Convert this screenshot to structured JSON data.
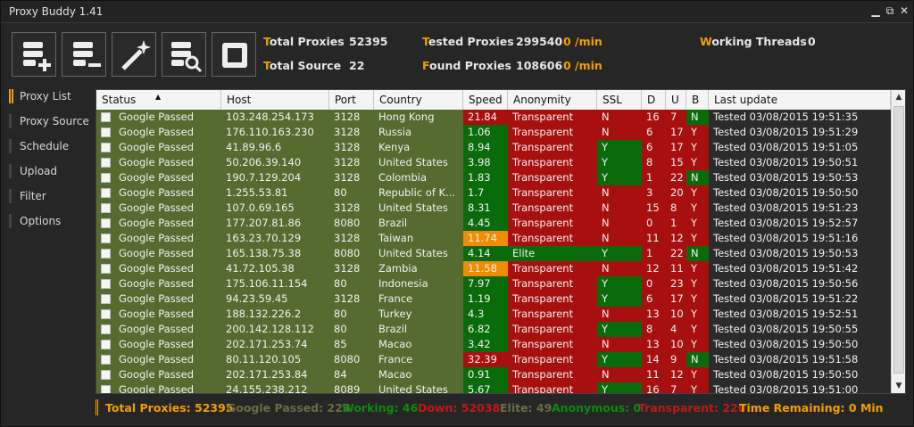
{
  "window": {
    "title": "Proxy Buddy 1.41",
    "min": "▁",
    "max": "⧉",
    "close": "✕"
  },
  "toolbar": {
    "buttons": [
      "add-list-icon",
      "remove-list-icon",
      "magic-wand-icon",
      "search-list-icon",
      "stop-icon"
    ]
  },
  "stats": {
    "total_proxies": {
      "first": "T",
      "rest": "otal Proxies",
      "value": "52395"
    },
    "total_source": {
      "first": "T",
      "rest": "otal Source",
      "value": "22"
    },
    "tested_proxies": {
      "first": "T",
      "rest": "ested Proxies",
      "value": "299540",
      "rate": "0 /min"
    },
    "found_proxies": {
      "first": "F",
      "rest": "ound Proxies",
      "value": "108606",
      "rate": "0 /min"
    },
    "working_threads": {
      "first": "W",
      "rest": "orking Threads",
      "value": "0"
    }
  },
  "sidebar": {
    "items": [
      {
        "label": "Proxy List"
      },
      {
        "label": "Proxy Source"
      },
      {
        "label": "Schedule"
      },
      {
        "label": "Upload"
      },
      {
        "label": "Filter"
      },
      {
        "label": "Options"
      }
    ]
  },
  "table": {
    "headers": [
      "Status",
      "Host",
      "Port",
      "Country",
      "Speed",
      "Anonymity",
      "SSL",
      "D",
      "U",
      "B",
      "Last update"
    ],
    "sort_indicator": "▲",
    "rows": [
      [
        "Google Passed",
        "103.248.254.173",
        "3128",
        "Hong Kong",
        "21.84",
        "Transparent",
        "N",
        "16",
        "7",
        "N",
        "Tested 03/08/2015 19:51:35"
      ],
      [
        "Google Passed",
        "176.110.163.230",
        "3128",
        "Russia",
        "1.06",
        "Transparent",
        "N",
        "6",
        "17",
        "Y",
        "Tested 03/08/2015 19:51:29"
      ],
      [
        "Google Passed",
        "41.89.96.6",
        "3128",
        "Kenya",
        "8.94",
        "Transparent",
        "Y",
        "6",
        "17",
        "Y",
        "Tested 03/08/2015 19:51:05"
      ],
      [
        "Google Passed",
        "50.206.39.140",
        "3128",
        "United States",
        "3.98",
        "Transparent",
        "Y",
        "8",
        "15",
        "Y",
        "Tested 03/08/2015 19:50:51"
      ],
      [
        "Google Passed",
        "190.7.129.204",
        "3128",
        "Colombia",
        "1.83",
        "Transparent",
        "Y",
        "1",
        "22",
        "N",
        "Tested 03/08/2015 19:50:53"
      ],
      [
        "Google Passed",
        "1.255.53.81",
        "80",
        "Republic of K...",
        "1.7",
        "Transparent",
        "N",
        "3",
        "20",
        "Y",
        "Tested 03/08/2015 19:50:50"
      ],
      [
        "Google Passed",
        "107.0.69.165",
        "3128",
        "United States",
        "8.31",
        "Transparent",
        "N",
        "15",
        "8",
        "Y",
        "Tested 03/08/2015 19:51:23"
      ],
      [
        "Google Passed",
        "177.207.81.86",
        "8080",
        "Brazil",
        "4.45",
        "Transparent",
        "N",
        "0",
        "1",
        "Y",
        "Tested 03/08/2015 19:52:57"
      ],
      [
        "Google Passed",
        "163.23.70.129",
        "3128",
        "Taiwan",
        "11.74",
        "Transparent",
        "N",
        "11",
        "12",
        "Y",
        "Tested 03/08/2015 19:51:16"
      ],
      [
        "Google Passed",
        "165.138.75.38",
        "8080",
        "United States",
        "4.14",
        "Elite",
        "Y",
        "1",
        "22",
        "N",
        "Tested 03/08/2015 19:50:53"
      ],
      [
        "Google Passed",
        "41.72.105.38",
        "3128",
        "Zambia",
        "11.58",
        "Transparent",
        "N",
        "12",
        "11",
        "Y",
        "Tested 03/08/2015 19:51:42"
      ],
      [
        "Google Passed",
        "175.106.11.154",
        "80",
        "Indonesia",
        "7.97",
        "Transparent",
        "Y",
        "0",
        "23",
        "Y",
        "Tested 03/08/2015 19:50:56"
      ],
      [
        "Google Passed",
        "94.23.59.45",
        "3128",
        "France",
        "1.19",
        "Transparent",
        "Y",
        "6",
        "17",
        "Y",
        "Tested 03/08/2015 19:51:22"
      ],
      [
        "Google Passed",
        "188.132.226.2",
        "80",
        "Turkey",
        "4.3",
        "Transparent",
        "N",
        "13",
        "10",
        "Y",
        "Tested 03/08/2015 19:52:51"
      ],
      [
        "Google Passed",
        "200.142.128.112",
        "80",
        "Brazil",
        "6.82",
        "Transparent",
        "Y",
        "8",
        "4",
        "Y",
        "Tested 03/08/2015 19:50:55"
      ],
      [
        "Google Passed",
        "202.171.253.74",
        "85",
        "Macao",
        "3.42",
        "Transparent",
        "N",
        "13",
        "10",
        "Y",
        "Tested 03/08/2015 19:50:50"
      ],
      [
        "Google Passed",
        "80.11.120.105",
        "8080",
        "France",
        "32.39",
        "Transparent",
        "Y",
        "14",
        "9",
        "N",
        "Tested 03/08/2015 19:51:58"
      ],
      [
        "Google Passed",
        "202.171.253.84",
        "84",
        "Macao",
        "0.91",
        "Transparent",
        "N",
        "11",
        "12",
        "Y",
        "Tested 03/08/2015 19:50:50"
      ],
      [
        "Google Passed",
        "24.155.238.212",
        "8089",
        "United States",
        "5.67",
        "Transparent",
        "Y",
        "16",
        "7",
        "Y",
        "Tested 03/08/2015 19:51:00"
      ]
    ],
    "speed_levels": [
      "red",
      "green",
      "green",
      "green",
      "green",
      "green",
      "green",
      "green",
      "orange",
      "green",
      "orange",
      "green",
      "green",
      "green",
      "green",
      "green",
      "red",
      "green",
      "green"
    ]
  },
  "colors": {
    "green_cell": "#556b2f",
    "green_bright": "#0a6b0a",
    "red": "#a80f0f",
    "orange": "#f08c00",
    "accent": "#f0a000"
  },
  "status_bar": {
    "total_proxies": "Total Proxies: 52395",
    "google_passed": "Google Passed: 223",
    "working": "Working: 46",
    "down": "Down: 52038",
    "elite": "Elite: 49",
    "anonymous": "Anonymous: 0",
    "transparent": "Transparent: 220",
    "time_remaining": "Time Remaining: 0 Min"
  }
}
